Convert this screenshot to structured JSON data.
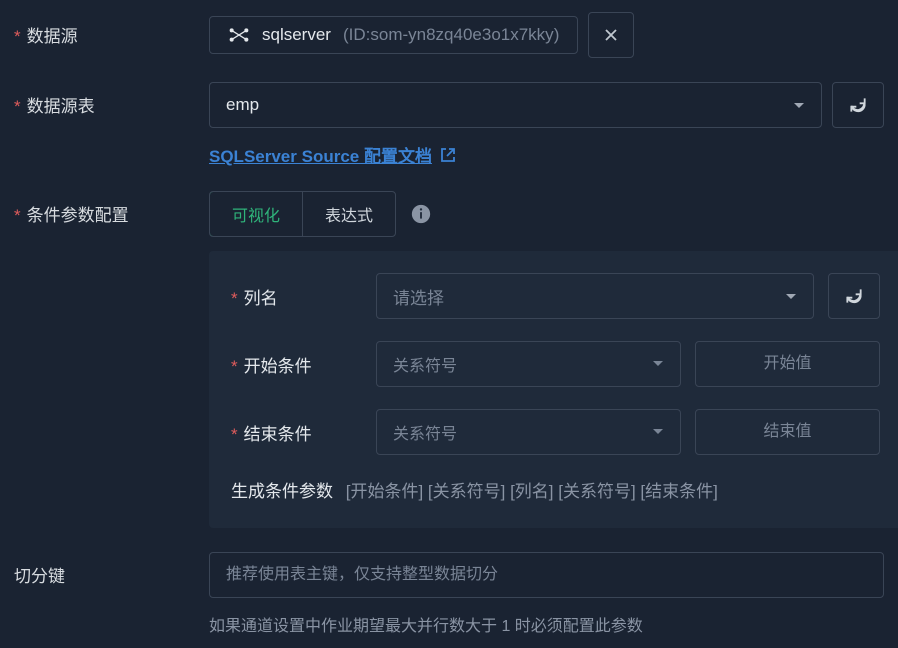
{
  "labels": {
    "datasource": "数据源",
    "datasource_table": "数据源表",
    "condition_config": "条件参数配置",
    "split_key": "切分键"
  },
  "datasource": {
    "name": "sqlserver",
    "id_prefix": "(ID:",
    "id_value": "som-yn8zq40e3o1x7kky",
    "id_suffix": ")"
  },
  "table": {
    "value": "emp"
  },
  "doc_link": {
    "text": "SQLServer Source 配置文档"
  },
  "tabs": {
    "visual": "可视化",
    "expression": "表达式"
  },
  "panel": {
    "column_label": "列名",
    "column_placeholder": "请选择",
    "start_label": "开始条件",
    "end_label": "结束条件",
    "relation_placeholder": "关系符号",
    "start_value_placeholder": "开始值",
    "end_value_placeholder": "结束值",
    "generated_label": "生成条件参数",
    "generated_pattern": "[开始条件] [关系符号] [列名] [关系符号] [结束条件]"
  },
  "split_key": {
    "placeholder": "推荐使用表主键，仅支持整型数据切分",
    "hint": "如果通道设置中作业期望最大并行数大于 1 时必须配置此参数"
  }
}
